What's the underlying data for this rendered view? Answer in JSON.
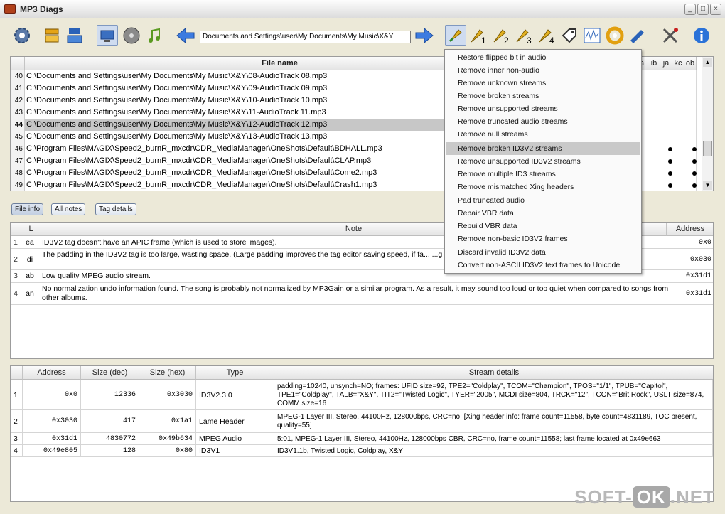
{
  "window": {
    "title": "MP3 Diags",
    "min": "_",
    "max": "□",
    "close": "×"
  },
  "toolbar": {
    "folder_path": "Documents and Settings\\user\\My Documents\\My Music\\X&Y"
  },
  "files": {
    "header": "File name",
    "note_cols": [
      "a",
      "ib",
      "ja",
      "kc",
      "ob"
    ],
    "rows": [
      {
        "n": "40",
        "path": "C:\\Documents and Settings\\user\\My Documents\\My Music\\X&Y\\08-AudioTrack 08.mp3"
      },
      {
        "n": "41",
        "path": "C:\\Documents and Settings\\user\\My Documents\\My Music\\X&Y\\09-AudioTrack 09.mp3"
      },
      {
        "n": "42",
        "path": "C:\\Documents and Settings\\user\\My Documents\\My Music\\X&Y\\10-AudioTrack 10.mp3"
      },
      {
        "n": "43",
        "path": "C:\\Documents and Settings\\user\\My Documents\\My Music\\X&Y\\11-AudioTrack 11.mp3"
      },
      {
        "n": "44",
        "path": "C:\\Documents and Settings\\user\\My Documents\\My Music\\X&Y\\12-AudioTrack 12.mp3"
      },
      {
        "n": "45",
        "path": "C:\\Documents and Settings\\user\\My Documents\\My Music\\X&Y\\13-AudioTrack 13.mp3"
      },
      {
        "n": "46",
        "path": "C:\\Program Files\\MAGIX\\Speed2_burnR_mxcdr\\CDR_MediaManager\\OneShots\\Default\\BDHALL.mp3"
      },
      {
        "n": "47",
        "path": "C:\\Program Files\\MAGIX\\Speed2_burnR_mxcdr\\CDR_MediaManager\\OneShots\\Default\\CLAP.mp3"
      },
      {
        "n": "48",
        "path": "C:\\Program Files\\MAGIX\\Speed2_burnR_mxcdr\\CDR_MediaManager\\OneShots\\Default\\Come2.mp3"
      },
      {
        "n": "49",
        "path": "C:\\Program Files\\MAGIX\\Speed2_burnR_mxcdr\\CDR_MediaManager\\OneShots\\Default\\Crash1.mp3"
      }
    ]
  },
  "tabs": {
    "file_info": "File info",
    "all_notes": "All notes",
    "tag_details": "Tag details"
  },
  "notes": {
    "headers": {
      "num": "",
      "level": "L",
      "note": "Note",
      "address": "Address"
    },
    "rows": [
      {
        "n": "1",
        "l": "ea",
        "text": "ID3V2 tag doesn't have an APIC frame (which is used to store images).",
        "addr": "0x0"
      },
      {
        "n": "2",
        "l": "di",
        "text": "The padding in the ID3V2 tag is too large, wasting space. (Large padding improves the tag editor saving speed, if fa... ...g the tag until after you're done with the tag editor.)",
        "addr": "0x030"
      },
      {
        "n": "3",
        "l": "ab",
        "text": "Low quality MPEG audio stream.",
        "addr": "0x31d1"
      },
      {
        "n": "4",
        "l": "an",
        "text": "No normalization undo information found. The song is probably not normalized by MP3Gain or a similar program. As a result, it may sound too loud or too quiet when compared to songs from other albums.",
        "addr": "0x31d1"
      }
    ]
  },
  "menu": {
    "items": [
      "Restore flipped bit in audio",
      "Remove inner non-audio",
      "Remove unknown streams",
      "Remove broken streams",
      "Remove unsupported streams",
      "Remove truncated audio streams",
      "Remove null streams",
      "Remove broken ID3V2 streams",
      "Remove unsupported ID3V2 streams",
      "Remove multiple ID3 streams",
      "Remove mismatched Xing headers",
      "Pad truncated audio",
      "Repair VBR data",
      "Rebuild VBR data",
      "Remove non-basic ID3V2 frames",
      "Discard invalid ID3V2 data",
      "Convert non-ASCII ID3V2 text frames to Unicode"
    ]
  },
  "streams": {
    "headers": {
      "num": "",
      "address": "Address",
      "size_dec": "Size (dec)",
      "size_hex": "Size (hex)",
      "type": "Type",
      "details": "Stream details"
    },
    "rows": [
      {
        "n": "1",
        "address": "0x0",
        "size_dec": "12336",
        "size_hex": "0x3030",
        "type": "ID3V2.3.0",
        "details": "padding=10240, unsynch=NO; frames: UFID size=92, TPE2=\"Coldplay\", TCOM=\"Champion\", TPOS=\"1/1\", TPUB=\"Capitol\", TPE1=\"Coldplay\", TALB=\"X&Y\", TIT2=\"Twisted Logic\", TYER=\"2005\", MCDI size=804, TRCK=\"12\", TCON=\"Brit Rock\", USLT size=874, COMM size=16"
      },
      {
        "n": "2",
        "address": "0x3030",
        "size_dec": "417",
        "size_hex": "0x1a1",
        "type": "Lame Header",
        "details": "MPEG-1 Layer III, Stereo, 44100Hz, 128000bps, CRC=no; [Xing header info: frame count=11558, byte count=4831189, TOC present, quality=55]"
      },
      {
        "n": "3",
        "address": "0x31d1",
        "size_dec": "4830772",
        "size_hex": "0x49b634",
        "type": "MPEG Audio",
        "details": "5:01, MPEG-1 Layer III, Stereo, 44100Hz, 128000bps CBR, CRC=no, frame count=11558; last frame located at 0x49e663"
      },
      {
        "n": "4",
        "address": "0x49e805",
        "size_dec": "128",
        "size_hex": "0x80",
        "type": "ID3V1",
        "details": "ID3V1.1b, Twisted Logic, Coldplay, X&Y"
      }
    ]
  },
  "watermark": {
    "left": "SOFT-",
    "mid": "OK",
    "right": ".NET"
  }
}
